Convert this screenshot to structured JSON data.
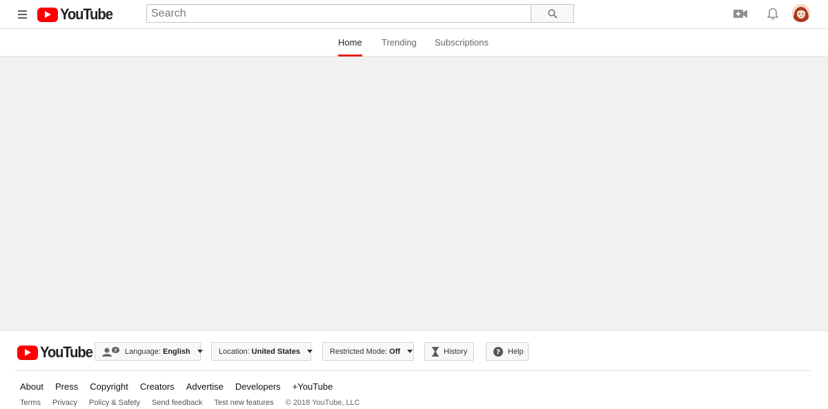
{
  "brand": {
    "name": "YouTube",
    "accent": "#ff0000"
  },
  "search": {
    "placeholder": "Search",
    "value": ""
  },
  "tabs": [
    {
      "label": "Home",
      "active": true
    },
    {
      "label": "Trending",
      "active": false
    },
    {
      "label": "Subscriptions",
      "active": false
    }
  ],
  "icons": {
    "menu": "hamburger-menu-icon",
    "search": "search-icon",
    "upload": "video-camera-plus-icon",
    "notifications": "bell-icon",
    "language": "language-people-icon",
    "history": "hourglass-icon",
    "help": "question-circle-icon"
  },
  "footer": {
    "language": {
      "label": "Language:",
      "value": "English"
    },
    "location": {
      "label": "Location:",
      "value": "United States"
    },
    "restricted": {
      "label": "Restricted Mode:",
      "value": "Off"
    },
    "history_label": "History",
    "help_label": "Help",
    "primary_links": [
      "About",
      "Press",
      "Copyright",
      "Creators",
      "Advertise",
      "Developers",
      "+YouTube"
    ],
    "secondary_links": [
      "Terms",
      "Privacy",
      "Policy & Safety",
      "Send feedback",
      "Test new features"
    ],
    "copyright": "© 2018 YouTube, LLC"
  },
  "colors": {
    "tab_indicator": "#e62117",
    "page_background": "#f1f1f1"
  }
}
